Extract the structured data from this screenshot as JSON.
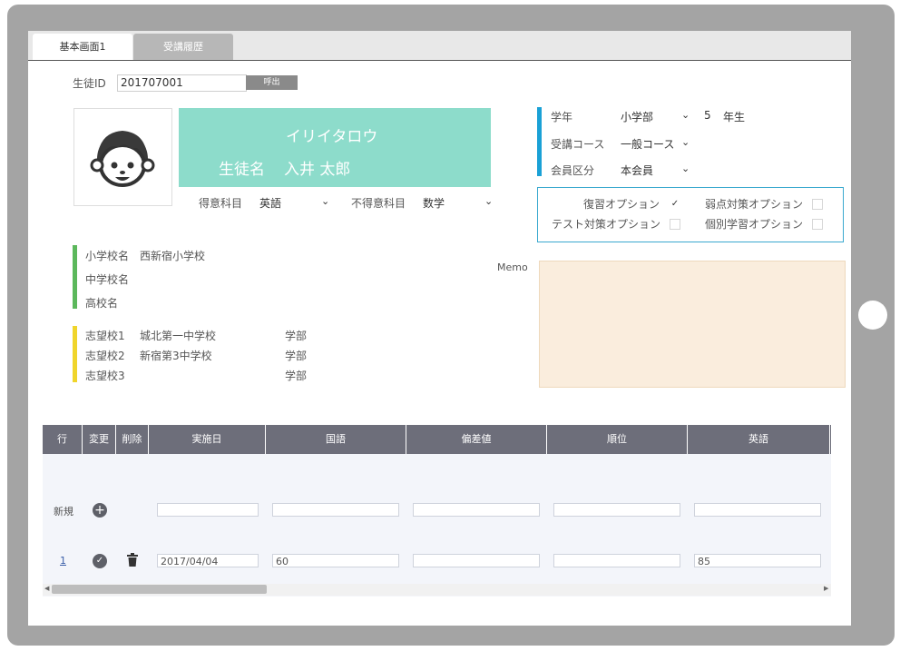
{
  "tabs": [
    "基本画面1",
    "受講履歴"
  ],
  "student_id": {
    "label": "生徒ID",
    "value": "201707001",
    "call_button": "呼出"
  },
  "name_card": {
    "kana": "イリイタロウ",
    "name_label": "生徒名",
    "name": "入井 太郎"
  },
  "subjects": {
    "good_label": "得意科目",
    "good_value": "英語",
    "weak_label": "不得意科目",
    "weak_value": "数学"
  },
  "grade": {
    "label": "学年",
    "value": "小学部",
    "number": "5",
    "suffix": "年生",
    "course_label": "受講コース",
    "course_value": "一般コース",
    "member_label": "会員区分",
    "member_value": "本会員"
  },
  "options": [
    {
      "label": "復習オプション",
      "checked": true
    },
    {
      "label": "弱点対策オプション",
      "checked": false
    },
    {
      "label": "テスト対策オプション",
      "checked": false
    },
    {
      "label": "個別学習オプション",
      "checked": false
    }
  ],
  "schools": [
    {
      "label": "小学校名",
      "value": "西新宿小学校"
    },
    {
      "label": "中学校名",
      "value": ""
    },
    {
      "label": "高校名",
      "value": ""
    }
  ],
  "wishes": [
    {
      "label": "志望校1",
      "school": "城北第一中学校",
      "dept": "学部"
    },
    {
      "label": "志望校2",
      "school": "新宿第3中学校",
      "dept": "学部"
    },
    {
      "label": "志望校3",
      "school": "",
      "dept": "学部"
    }
  ],
  "memo_label": "Memo",
  "grid": {
    "headers": [
      "行",
      "変更",
      "削除",
      "実施日",
      "国語",
      "偏差値",
      "順位",
      "英語"
    ],
    "new_label": "新規",
    "rows": [
      {
        "no": "1",
        "date": "2017/04/04",
        "kokugo": "60",
        "hensachi": "",
        "juni": "",
        "eigo": "85"
      }
    ]
  },
  "colors": {
    "name_bg": "#8ddccb",
    "school_bar": "#5cb85c",
    "wish_bar": "#f0d52b",
    "grade_bar": "#1aa1d6",
    "option_border": "#3aa9cf",
    "memo_bg": "#faeddd",
    "grid_header": "#6d6e7a"
  }
}
